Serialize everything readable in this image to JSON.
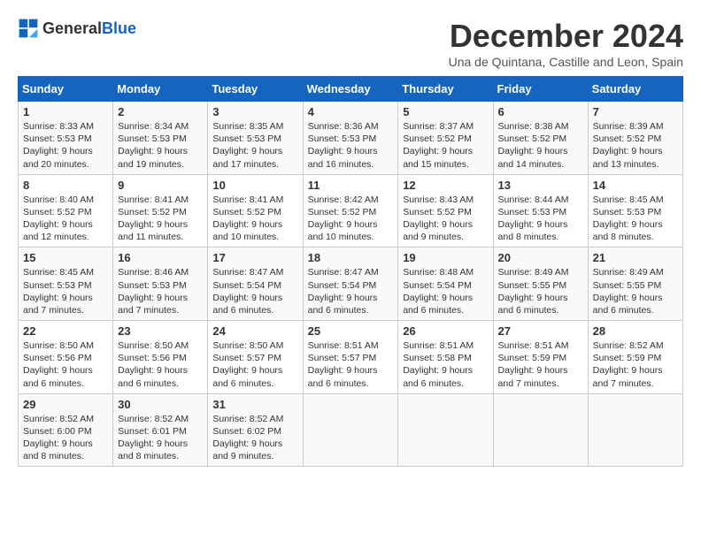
{
  "header": {
    "logo_general": "General",
    "logo_blue": "Blue",
    "title": "December 2024",
    "subtitle": "Una de Quintana, Castille and Leon, Spain"
  },
  "days_of_week": [
    "Sunday",
    "Monday",
    "Tuesday",
    "Wednesday",
    "Thursday",
    "Friday",
    "Saturday"
  ],
  "weeks": [
    [
      {
        "day": 1,
        "sunrise": "8:33 AM",
        "sunset": "5:53 PM",
        "daylight": "9 hours and 20 minutes."
      },
      {
        "day": 2,
        "sunrise": "8:34 AM",
        "sunset": "5:53 PM",
        "daylight": "9 hours and 19 minutes."
      },
      {
        "day": 3,
        "sunrise": "8:35 AM",
        "sunset": "5:53 PM",
        "daylight": "9 hours and 17 minutes."
      },
      {
        "day": 4,
        "sunrise": "8:36 AM",
        "sunset": "5:53 PM",
        "daylight": "9 hours and 16 minutes."
      },
      {
        "day": 5,
        "sunrise": "8:37 AM",
        "sunset": "5:52 PM",
        "daylight": "9 hours and 15 minutes."
      },
      {
        "day": 6,
        "sunrise": "8:38 AM",
        "sunset": "5:52 PM",
        "daylight": "9 hours and 14 minutes."
      },
      {
        "day": 7,
        "sunrise": "8:39 AM",
        "sunset": "5:52 PM",
        "daylight": "9 hours and 13 minutes."
      }
    ],
    [
      {
        "day": 8,
        "sunrise": "8:40 AM",
        "sunset": "5:52 PM",
        "daylight": "9 hours and 12 minutes."
      },
      {
        "day": 9,
        "sunrise": "8:41 AM",
        "sunset": "5:52 PM",
        "daylight": "9 hours and 11 minutes."
      },
      {
        "day": 10,
        "sunrise": "8:41 AM",
        "sunset": "5:52 PM",
        "daylight": "9 hours and 10 minutes."
      },
      {
        "day": 11,
        "sunrise": "8:42 AM",
        "sunset": "5:52 PM",
        "daylight": "9 hours and 10 minutes."
      },
      {
        "day": 12,
        "sunrise": "8:43 AM",
        "sunset": "5:52 PM",
        "daylight": "9 hours and 9 minutes."
      },
      {
        "day": 13,
        "sunrise": "8:44 AM",
        "sunset": "5:53 PM",
        "daylight": "9 hours and 8 minutes."
      },
      {
        "day": 14,
        "sunrise": "8:45 AM",
        "sunset": "5:53 PM",
        "daylight": "9 hours and 8 minutes."
      }
    ],
    [
      {
        "day": 15,
        "sunrise": "8:45 AM",
        "sunset": "5:53 PM",
        "daylight": "9 hours and 7 minutes."
      },
      {
        "day": 16,
        "sunrise": "8:46 AM",
        "sunset": "5:53 PM",
        "daylight": "9 hours and 7 minutes."
      },
      {
        "day": 17,
        "sunrise": "8:47 AM",
        "sunset": "5:54 PM",
        "daylight": "9 hours and 6 minutes."
      },
      {
        "day": 18,
        "sunrise": "8:47 AM",
        "sunset": "5:54 PM",
        "daylight": "9 hours and 6 minutes."
      },
      {
        "day": 19,
        "sunrise": "8:48 AM",
        "sunset": "5:54 PM",
        "daylight": "9 hours and 6 minutes."
      },
      {
        "day": 20,
        "sunrise": "8:49 AM",
        "sunset": "5:55 PM",
        "daylight": "9 hours and 6 minutes."
      },
      {
        "day": 21,
        "sunrise": "8:49 AM",
        "sunset": "5:55 PM",
        "daylight": "9 hours and 6 minutes."
      }
    ],
    [
      {
        "day": 22,
        "sunrise": "8:50 AM",
        "sunset": "5:56 PM",
        "daylight": "9 hours and 6 minutes."
      },
      {
        "day": 23,
        "sunrise": "8:50 AM",
        "sunset": "5:56 PM",
        "daylight": "9 hours and 6 minutes."
      },
      {
        "day": 24,
        "sunrise": "8:50 AM",
        "sunset": "5:57 PM",
        "daylight": "9 hours and 6 minutes."
      },
      {
        "day": 25,
        "sunrise": "8:51 AM",
        "sunset": "5:57 PM",
        "daylight": "9 hours and 6 minutes."
      },
      {
        "day": 26,
        "sunrise": "8:51 AM",
        "sunset": "5:58 PM",
        "daylight": "9 hours and 6 minutes."
      },
      {
        "day": 27,
        "sunrise": "8:51 AM",
        "sunset": "5:59 PM",
        "daylight": "9 hours and 7 minutes."
      },
      {
        "day": 28,
        "sunrise": "8:52 AM",
        "sunset": "5:59 PM",
        "daylight": "9 hours and 7 minutes."
      }
    ],
    [
      {
        "day": 29,
        "sunrise": "8:52 AM",
        "sunset": "6:00 PM",
        "daylight": "9 hours and 8 minutes."
      },
      {
        "day": 30,
        "sunrise": "8:52 AM",
        "sunset": "6:01 PM",
        "daylight": "9 hours and 8 minutes."
      },
      {
        "day": 31,
        "sunrise": "8:52 AM",
        "sunset": "6:02 PM",
        "daylight": "9 hours and 9 minutes."
      },
      null,
      null,
      null,
      null
    ]
  ]
}
